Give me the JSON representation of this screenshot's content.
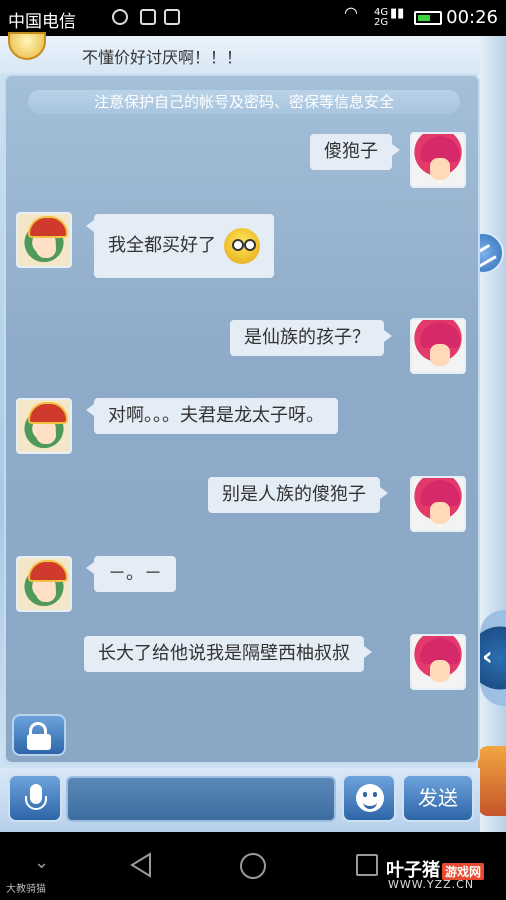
{
  "status_bar": {
    "carrier": "中国电信",
    "network": "4G",
    "network2": "2G",
    "time": "00:26"
  },
  "previous_message": "不懂价好讨厌啊！！！",
  "notice": "注意保护自己的帐号及密码、密保等信息安全",
  "messages": [
    {
      "from": "me",
      "text": "傻狍子"
    },
    {
      "from": "her",
      "text": "我全都买好了",
      "emoji": "worried-face"
    },
    {
      "from": "me",
      "text": "是仙族的孩子？"
    },
    {
      "from": "her",
      "text": "对啊。。。夫君是龙太子呀。"
    },
    {
      "from": "me",
      "text": "别是人族的傻狍子"
    },
    {
      "from": "her",
      "text": "－。－"
    },
    {
      "from": "me",
      "text": "长大了给他说我是隔壁西柚叔叔"
    }
  ],
  "input_bar": {
    "input_value": "",
    "send_label": "发送"
  },
  "watermarks": {
    "left": "大教骑猫",
    "brand": "叶子猪",
    "brand_tag": "游戏网",
    "url": "WWW.YZZ.CN"
  },
  "colors": {
    "chat_panel": "#8eabc9",
    "bubble": "#e4ecf5",
    "button": "#2e65a8"
  }
}
